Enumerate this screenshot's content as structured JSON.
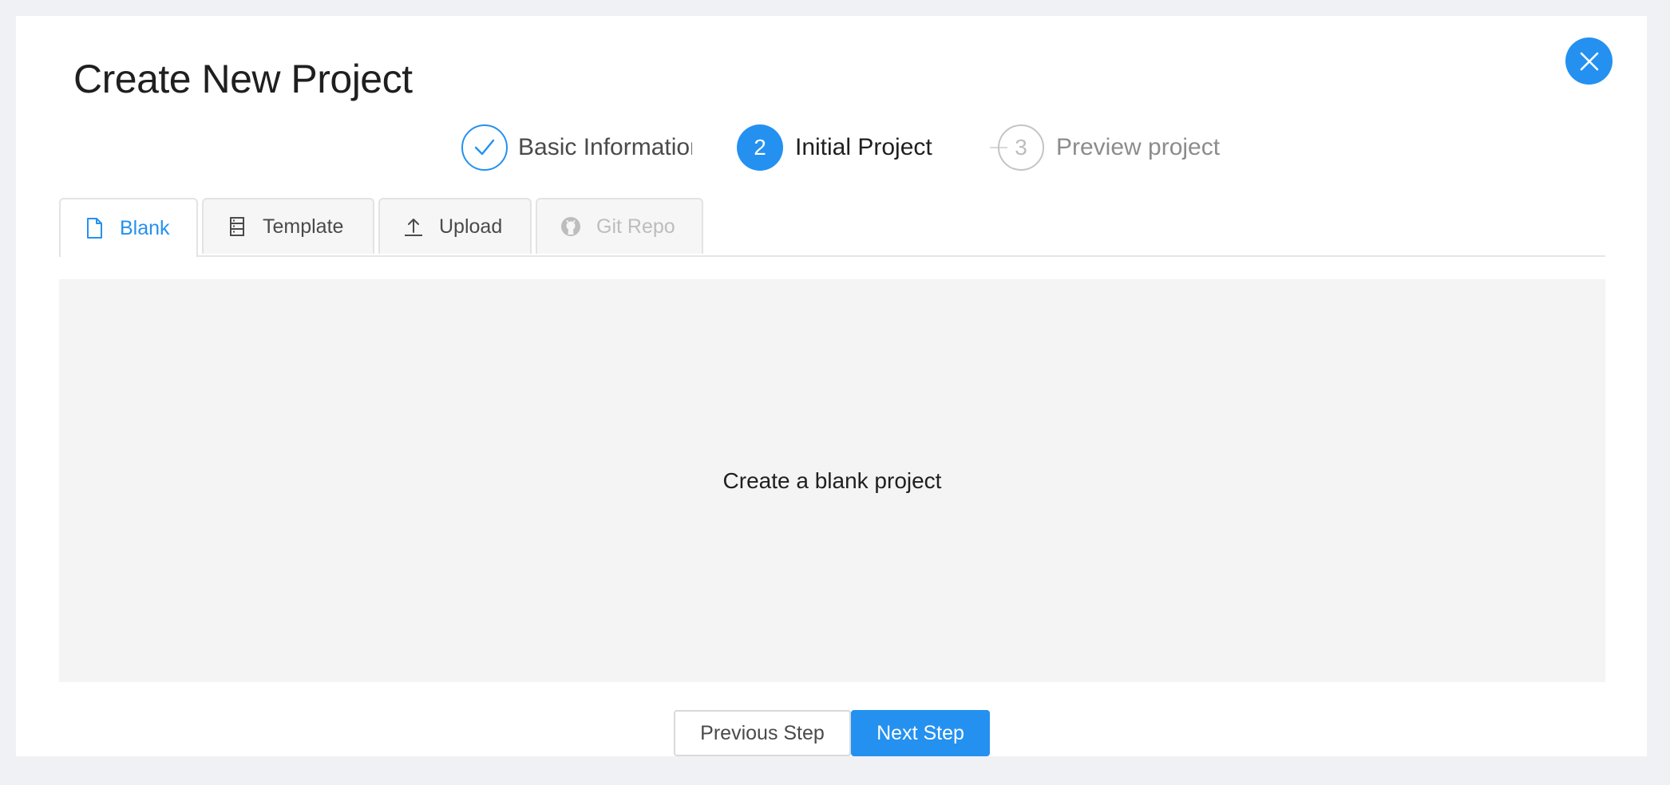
{
  "modal": {
    "title": "Create New Project"
  },
  "steps": [
    {
      "label": "Basic Information",
      "status": "finished",
      "icon": "check-icon"
    },
    {
      "number": "2",
      "label": "Initial Project",
      "status": "active"
    },
    {
      "number": "3",
      "label": "Preview project",
      "status": "waiting"
    }
  ],
  "tabs": [
    {
      "label": "Blank",
      "icon": "file-icon",
      "active": true
    },
    {
      "label": "Template",
      "icon": "template-icon"
    },
    {
      "label": "Upload",
      "icon": "upload-icon"
    },
    {
      "label": "Git Repo",
      "icon": "github-icon",
      "disabled": true
    }
  ],
  "content": {
    "text": "Create a blank project"
  },
  "footer": {
    "prev_label": "Previous Step",
    "next_label": "Next Step"
  },
  "colors": {
    "primary": "#2491f0",
    "panel_bg": "#f4f4f5",
    "page_bg": "#eff1f4"
  }
}
